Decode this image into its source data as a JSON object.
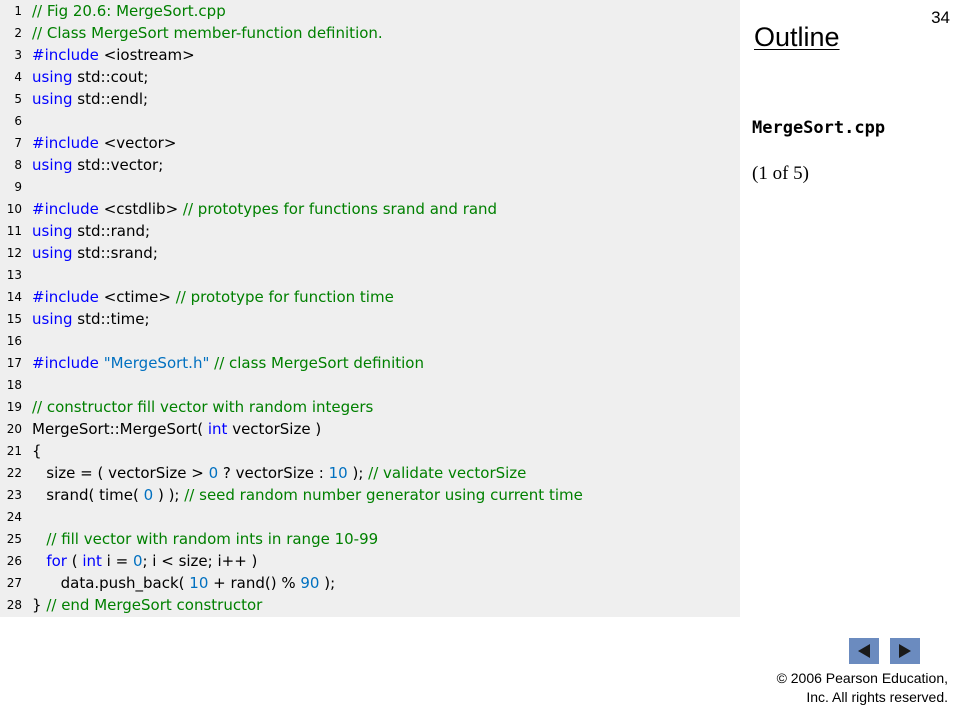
{
  "slide_number": "34",
  "outline": {
    "title": "Outline",
    "file_name": "MergeSort.cpp",
    "page_indicator": "(1 of 5)"
  },
  "footer": {
    "copyright_line1": "© 2006 Pearson Education,",
    "copyright_line2": "Inc.  All rights reserved."
  },
  "navigation": {
    "prev_icon": "triangle-left-icon",
    "next_icon": "triangle-right-icon",
    "button_color": "#6b8bbf"
  },
  "code_colors": {
    "comment": "#008000",
    "keyword": "#0000ff",
    "literal": "#0070c0",
    "text": "#000000",
    "panel_background": "#efefef"
  },
  "code_lines": [
    {
      "num": "1",
      "tokens": [
        {
          "t": "// Fig 20.6: MergeSort.cpp",
          "c": "c"
        }
      ]
    },
    {
      "num": "2",
      "tokens": [
        {
          "t": "// Class MergeSort member-function definition.",
          "c": "c"
        }
      ]
    },
    {
      "num": "3",
      "tokens": [
        {
          "t": "#include",
          "c": "k"
        },
        {
          "t": " <iostream>",
          "c": ""
        }
      ]
    },
    {
      "num": "4",
      "tokens": [
        {
          "t": "using",
          "c": "k"
        },
        {
          "t": " std::cout;",
          "c": ""
        }
      ]
    },
    {
      "num": "5",
      "tokens": [
        {
          "t": "using",
          "c": "k"
        },
        {
          "t": " std::endl;",
          "c": ""
        }
      ]
    },
    {
      "num": "6",
      "tokens": []
    },
    {
      "num": "7",
      "tokens": [
        {
          "t": "#include",
          "c": "k"
        },
        {
          "t": " <vector>",
          "c": ""
        }
      ]
    },
    {
      "num": "8",
      "tokens": [
        {
          "t": "using",
          "c": "k"
        },
        {
          "t": " std::vector;",
          "c": ""
        }
      ]
    },
    {
      "num": "9",
      "tokens": []
    },
    {
      "num": "10",
      "tokens": [
        {
          "t": "#include",
          "c": "k"
        },
        {
          "t": " <cstdlib> ",
          "c": ""
        },
        {
          "t": "// prototypes for functions srand and rand",
          "c": "c"
        }
      ]
    },
    {
      "num": "11",
      "tokens": [
        {
          "t": "using",
          "c": "k"
        },
        {
          "t": " std::rand;",
          "c": ""
        }
      ]
    },
    {
      "num": "12",
      "tokens": [
        {
          "t": "using",
          "c": "k"
        },
        {
          "t": " std::srand;",
          "c": ""
        }
      ]
    },
    {
      "num": "13",
      "tokens": []
    },
    {
      "num": "14",
      "tokens": [
        {
          "t": "#include",
          "c": "k"
        },
        {
          "t": " <ctime> ",
          "c": ""
        },
        {
          "t": "// prototype for function time",
          "c": "c"
        }
      ]
    },
    {
      "num": "15",
      "tokens": [
        {
          "t": "using",
          "c": "k"
        },
        {
          "t": " std::time;",
          "c": ""
        }
      ]
    },
    {
      "num": "16",
      "tokens": []
    },
    {
      "num": "17",
      "tokens": [
        {
          "t": "#include",
          "c": "k"
        },
        {
          "t": " ",
          "c": ""
        },
        {
          "t": "\"MergeSort.h\"",
          "c": "s"
        },
        {
          "t": " ",
          "c": ""
        },
        {
          "t": "// class MergeSort definition",
          "c": "c"
        }
      ]
    },
    {
      "num": "18",
      "tokens": []
    },
    {
      "num": "19",
      "tokens": [
        {
          "t": "// constructor fill vector with random integers",
          "c": "c"
        }
      ]
    },
    {
      "num": "20",
      "tokens": [
        {
          "t": "MergeSort::MergeSort( ",
          "c": ""
        },
        {
          "t": "int",
          "c": "k"
        },
        {
          "t": " vectorSize )",
          "c": ""
        }
      ]
    },
    {
      "num": "21",
      "tokens": [
        {
          "t": "{",
          "c": ""
        }
      ]
    },
    {
      "num": "22",
      "tokens": [
        {
          "t": "   size = ( vectorSize > ",
          "c": ""
        },
        {
          "t": "0",
          "c": "n"
        },
        {
          "t": " ? vectorSize : ",
          "c": ""
        },
        {
          "t": "10",
          "c": "n"
        },
        {
          "t": " ); ",
          "c": ""
        },
        {
          "t": "// validate vectorSize",
          "c": "c"
        }
      ]
    },
    {
      "num": "23",
      "tokens": [
        {
          "t": "   srand( time( ",
          "c": ""
        },
        {
          "t": "0",
          "c": "n"
        },
        {
          "t": " ) ); ",
          "c": ""
        },
        {
          "t": "// seed random number generator using current time",
          "c": "c"
        }
      ]
    },
    {
      "num": "24",
      "tokens": []
    },
    {
      "num": "25",
      "tokens": [
        {
          "t": "   ",
          "c": ""
        },
        {
          "t": "// fill vector with random ints in range 10-99",
          "c": "c"
        }
      ]
    },
    {
      "num": "26",
      "tokens": [
        {
          "t": "   ",
          "c": ""
        },
        {
          "t": "for",
          "c": "k"
        },
        {
          "t": " ( ",
          "c": ""
        },
        {
          "t": "int",
          "c": "k"
        },
        {
          "t": " i = ",
          "c": ""
        },
        {
          "t": "0",
          "c": "n"
        },
        {
          "t": "; i < size; i++ )",
          "c": ""
        }
      ]
    },
    {
      "num": "27",
      "tokens": [
        {
          "t": "      data.push_back( ",
          "c": ""
        },
        {
          "t": "10",
          "c": "n"
        },
        {
          "t": " + rand() % ",
          "c": ""
        },
        {
          "t": "90",
          "c": "n"
        },
        {
          "t": " );",
          "c": ""
        }
      ]
    },
    {
      "num": "28",
      "tokens": [
        {
          "t": "} ",
          "c": ""
        },
        {
          "t": "// end MergeSort constructor",
          "c": "c"
        }
      ]
    }
  ]
}
